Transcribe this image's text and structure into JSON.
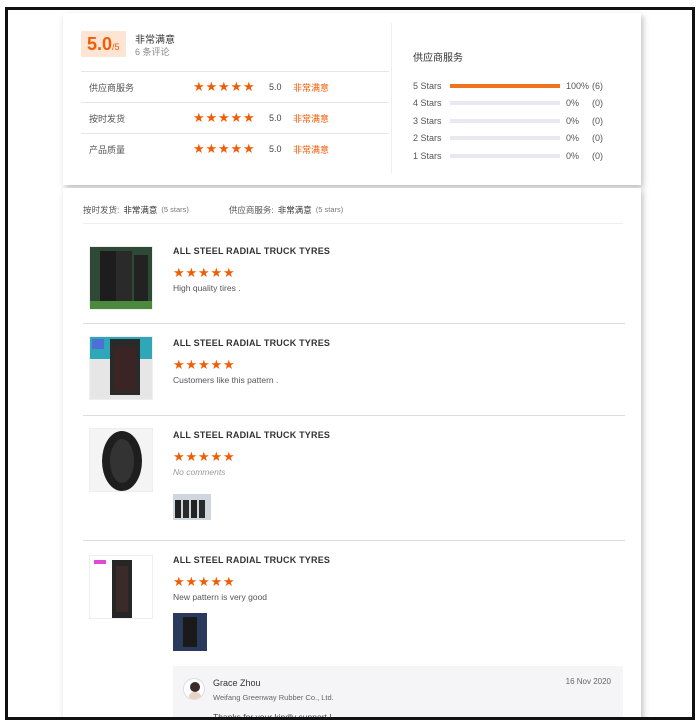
{
  "summary": {
    "score": "5.0",
    "score_suffix": "/5",
    "title": "非常满意",
    "count": "6 条评论",
    "ratings": [
      {
        "label": "供应商服务",
        "score": "5.0",
        "text": "非常满意"
      },
      {
        "label": "按时发货",
        "score": "5.0",
        "text": "非常满意"
      },
      {
        "label": "产品质量",
        "score": "5.0",
        "text": "非常满意"
      }
    ],
    "distribution_title": "供应商服务",
    "distribution": [
      {
        "label": "5 Stars",
        "pct": "100%",
        "count": "(6)",
        "fraction": 1.0
      },
      {
        "label": "4 Stars",
        "pct": "0%",
        "count": "(0)",
        "fraction": 0
      },
      {
        "label": "3 Stars",
        "pct": "0%",
        "count": "(0)",
        "fraction": 0
      },
      {
        "label": "2 Stars",
        "pct": "0%",
        "count": "(0)",
        "fraction": 0
      },
      {
        "label": "1 Stars",
        "pct": "0%",
        "count": "(0)",
        "fraction": 0
      }
    ]
  },
  "filter_bar": {
    "shipping_label": "按时发货:",
    "shipping_value": "非常满意",
    "shipping_stars": "(5 stars)",
    "service_label": "供应商服务:",
    "service_value": "非常满意",
    "service_stars": "(5 stars)"
  },
  "reviews": [
    {
      "title": "ALL STEEL RADIAL TRUCK TYRES",
      "stars": 5,
      "text": "High quality tires ."
    },
    {
      "title": "ALL STEEL RADIAL TRUCK TYRES",
      "stars": 5,
      "text": "Customers like this pattern ."
    },
    {
      "title": "ALL STEEL RADIAL TRUCK TYRES",
      "stars": 5,
      "text": "No comments"
    },
    {
      "title": "ALL STEEL RADIAL TRUCK TYRES",
      "stars": 5,
      "text": "New pattern is very good"
    }
  ],
  "reply": {
    "name": "Grace Zhou",
    "company": "Weifang Greenway Rubber Co., Ltd.",
    "date": "16 Nov 2020",
    "message": "Thanks for your kindly support !"
  },
  "colors": {
    "accent": "#f25c05",
    "bar_fill": "#f0741b",
    "score_bg": "#fde4d3"
  }
}
